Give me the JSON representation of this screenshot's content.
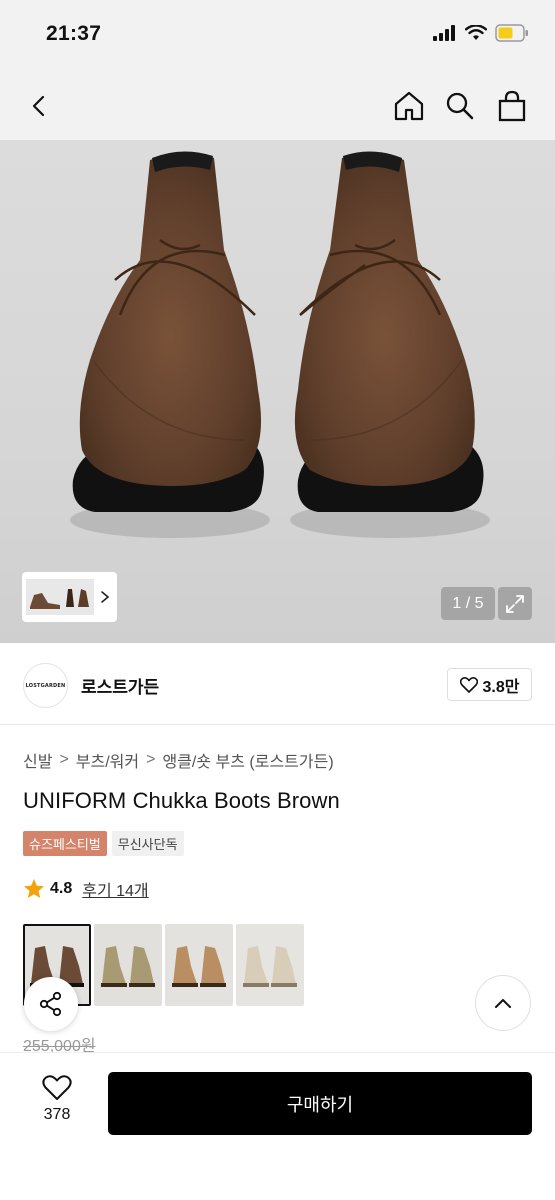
{
  "status_bar": {
    "time": "21:37"
  },
  "hero": {
    "counter": "1 / 5"
  },
  "brand": {
    "logo_text": "LOSTGARDEN",
    "name": "로스트가든",
    "likes": "3.8만"
  },
  "breadcrumb": [
    "신발",
    "부츠/워커",
    "앵클/숏 부츠 (로스트가든)"
  ],
  "product": {
    "title": "UNIFORM Chukka Boots Brown",
    "tags": [
      "슈즈페스티벌",
      "무신사단독"
    ],
    "rating": "4.8",
    "reviews": "후기 14개",
    "original_price": "255,000원"
  },
  "variants": [
    {
      "color": "#6b4a36",
      "selected": true
    },
    {
      "color": "#a89a72",
      "selected": false
    },
    {
      "color": "#b88e62",
      "selected": false
    },
    {
      "color": "#d8cdb8",
      "selected": false
    }
  ],
  "bottom": {
    "wish_count": "378",
    "buy_label": "구매하기"
  },
  "colors": {
    "sale_tag": "#d4846a",
    "star": "#f2a20c",
    "boot": "#5e3e2b",
    "buy_button": "#000000"
  }
}
